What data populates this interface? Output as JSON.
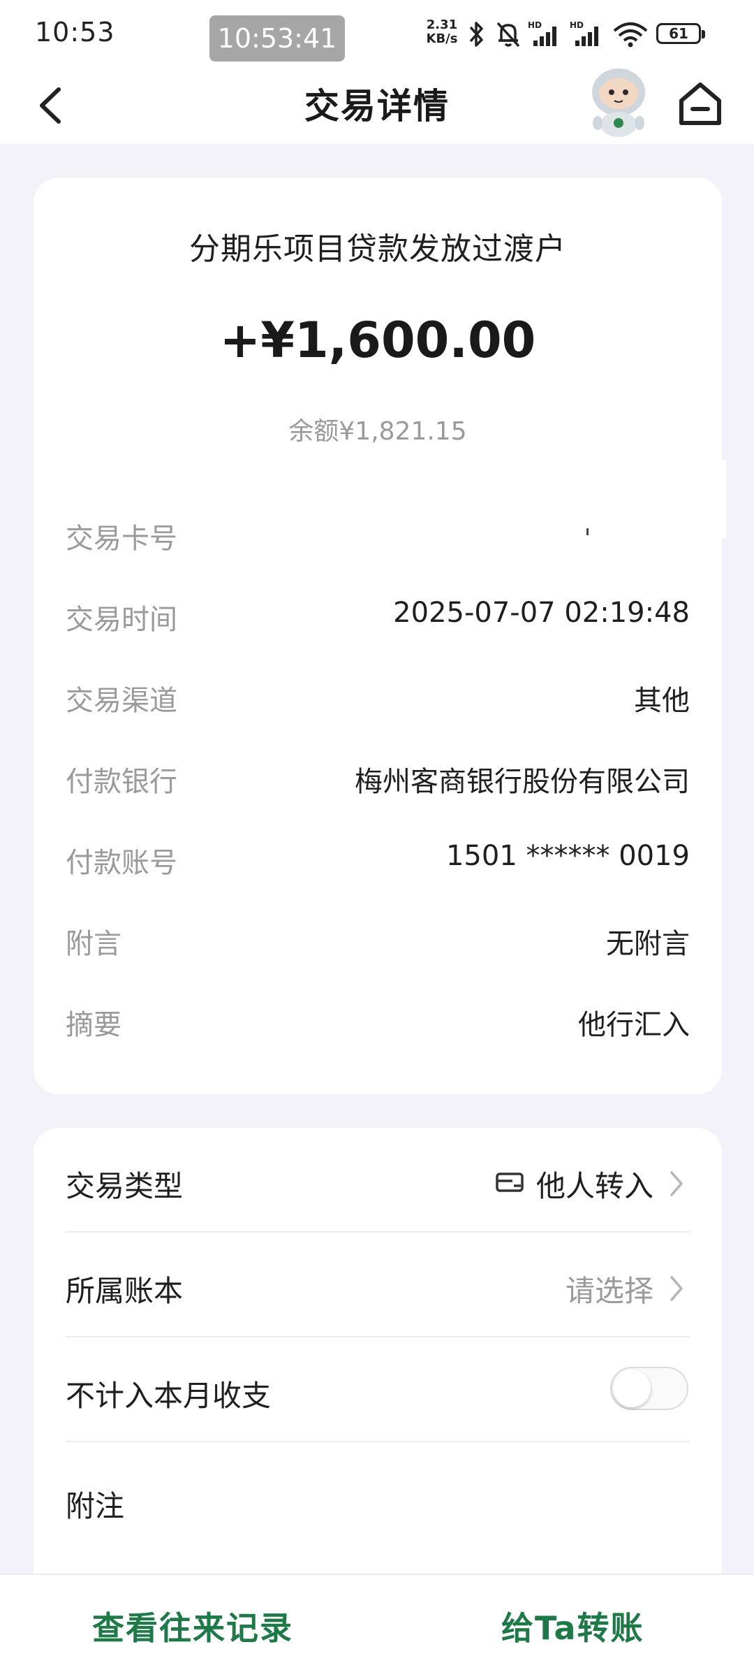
{
  "status_bar": {
    "time": "10:53",
    "clock_pill": "10:53:41",
    "speed_value": "2.31",
    "speed_unit": "KB/s",
    "battery": "61",
    "icons": [
      "bluetooth-icon",
      "bell-off-icon",
      "signal-hd-icon",
      "signal-hd-icon",
      "wifi-icon",
      "battery-icon"
    ]
  },
  "nav": {
    "title": "交易详情",
    "back_icon": "chevron-left-icon",
    "mascot_icon": "astronaut-mascot-icon",
    "home_icon": "home-icon"
  },
  "transaction": {
    "payer_name": "分期乐项目贷款发放过渡户",
    "amount": "+¥1,600.00",
    "balance": "余额¥1,821.15",
    "details": [
      {
        "label": "交易卡号",
        "value": ""
      },
      {
        "label": "交易时间",
        "value": "2025-07-07 02:19:48"
      },
      {
        "label": "交易渠道",
        "value": "其他"
      },
      {
        "label": "付款银行",
        "value": "梅州客商银行股份有限公司"
      },
      {
        "label": "付款账号",
        "value": "1501 ****** 0019"
      },
      {
        "label": "附言",
        "value": "无附言"
      },
      {
        "label": "摘要",
        "value": "他行汇入"
      }
    ]
  },
  "settings": {
    "type": {
      "label": "交易类型",
      "value": "他人转入"
    },
    "book": {
      "label": "所属账本",
      "value": "请选择"
    },
    "exclude": {
      "label": "不计入本月收支",
      "enabled": false
    },
    "note": {
      "label": "附注"
    }
  },
  "bottom_bar": {
    "left_label": "查看往来记录",
    "right_label": "给Ta转账"
  },
  "colors": {
    "accent_green": "#1b7a45",
    "page_bg": "#f3f2f8",
    "label_gray": "#9a9a9a"
  }
}
